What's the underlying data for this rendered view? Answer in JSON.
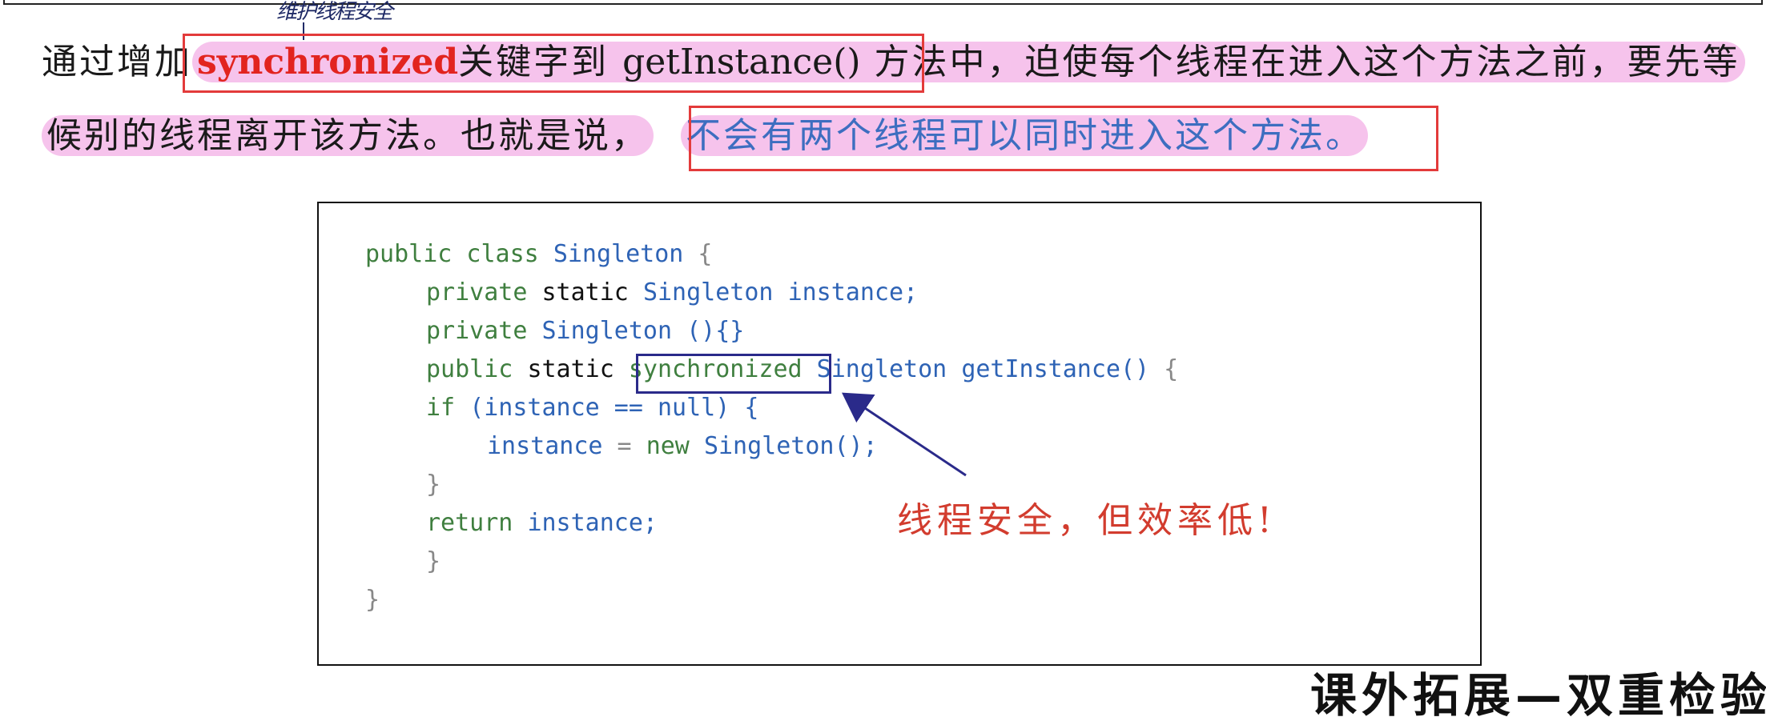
{
  "annotation": {
    "handwritten_note": "维护线程安全"
  },
  "paragraph": {
    "line1": {
      "prefix": "通过增加",
      "keyword": "synchronized",
      "mid1": "关键字到 ",
      "method": "getInstance()",
      "mid2": " 方法中",
      "rest": "，迫使每个线程在进入这个方法之前，要先等"
    },
    "line2": {
      "prefix": "候别的线程离开该方法。也就是说，",
      "highlight": "不会有两个线程可以同时进入这个方法。"
    }
  },
  "code": {
    "l1_kw": "public class ",
    "l1_name": "Singleton",
    "l1_brace": " {",
    "l2_kw": "private ",
    "l2_static": "static ",
    "l2_type": "Singleton ",
    "l2_var": "instance;",
    "l3_kw": "private ",
    "l3_ctor": "Singleton ",
    "l3_rest": "(){}",
    "l4_kw": "public ",
    "l4_static": "static ",
    "l4_sync": "synchronized",
    "l4_type": " Singleton ",
    "l4_method": "getInstance()",
    "l4_brace": " {",
    "l5_kw": "if ",
    "l5_rest": "(instance == null) {",
    "l6_var": "instance",
    "l6_op": " = ",
    "l6_new": "new ",
    "l6_rest": "Singleton();",
    "l7": "}",
    "l8_kw": "return ",
    "l8_var": "instance;",
    "l9": "}",
    "l10": "}"
  },
  "callout": {
    "text": "线程安全，但效率低!"
  },
  "footer": {
    "title_partial": "课外拓展—双重检验锁"
  },
  "colors": {
    "highlight_pink": "#f6c3ec",
    "red_box": "#e33b3b",
    "keyword_red": "#e2241f",
    "blue_text": "#3d6ec0",
    "sync_box": "#2a2a8a",
    "callout_red": "#d23c2e"
  }
}
